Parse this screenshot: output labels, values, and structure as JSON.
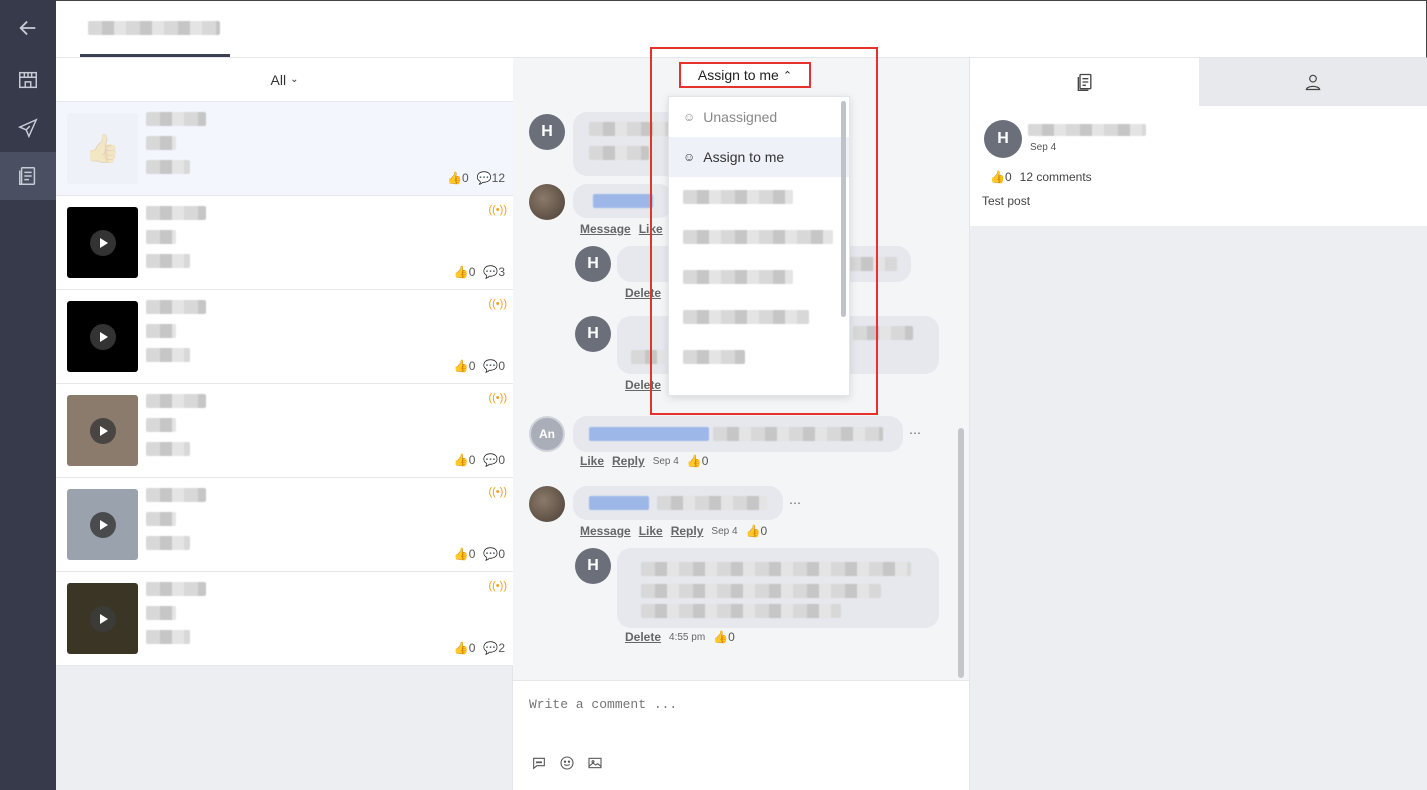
{
  "nav": {
    "items": [
      {
        "icon": "back-arrow-icon"
      },
      {
        "icon": "store-icon"
      },
      {
        "icon": "paper-plane-icon"
      },
      {
        "icon": "document-list-icon"
      }
    ]
  },
  "list": {
    "filter_label": "All",
    "posts": [
      {
        "likes": "0",
        "comments": "12",
        "live": false,
        "thumb": "like",
        "thumb_color": "#eef2f8"
      },
      {
        "likes": "0",
        "comments": "3",
        "live": true,
        "thumb": "video",
        "thumb_color": "#000000"
      },
      {
        "likes": "0",
        "comments": "0",
        "live": true,
        "thumb": "video",
        "thumb_color": "#000000"
      },
      {
        "likes": "0",
        "comments": "0",
        "live": true,
        "thumb": "video",
        "thumb_color": "#8a7b6c"
      },
      {
        "likes": "0",
        "comments": "0",
        "live": true,
        "thumb": "video",
        "thumb_color": "#9aa3ad"
      },
      {
        "likes": "0",
        "comments": "2",
        "live": true,
        "thumb": "video",
        "thumb_color": "#3a3524"
      }
    ]
  },
  "comments": {
    "assign_label": "Assign to me",
    "dropdown": {
      "unassigned": "Unassigned",
      "assign_me": "Assign to me"
    },
    "actions": {
      "message": "Message",
      "like": "Like",
      "reply": "Reply",
      "delete": "Delete"
    },
    "anon_initials": "An",
    "avatar_initial": "H",
    "c_an": {
      "date": "Sep 4",
      "likes": "0"
    },
    "c_photo2": {
      "date": "Sep 4",
      "likes": "0"
    },
    "c_reply_last": {
      "time": "4:55 pm",
      "likes": "0"
    },
    "compose_placeholder": "Write a comment ..."
  },
  "detail": {
    "avatar_initial": "H",
    "date": "Sep 4",
    "likes": "0",
    "comments_label": "12 comments",
    "text": "Test post"
  },
  "colors": {
    "highlight": "#e5322d",
    "live": "#f0a020",
    "nav_bg": "#363a4a"
  }
}
